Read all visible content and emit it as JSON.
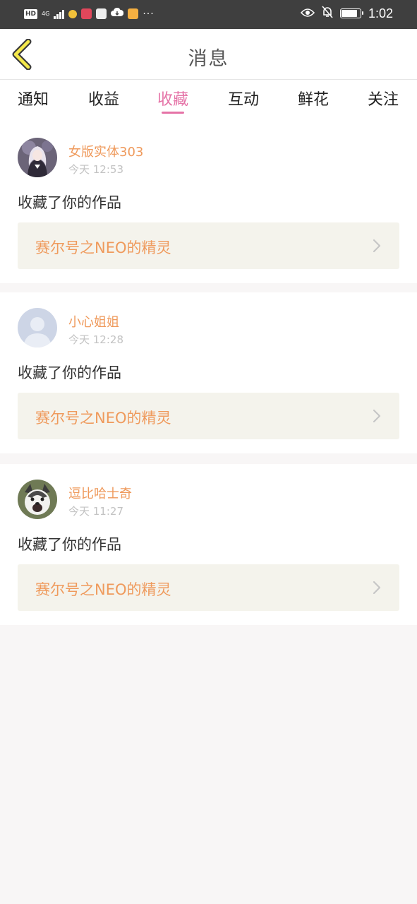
{
  "status_bar": {
    "hd": "HD",
    "network": "4G",
    "time": "1:02",
    "battery_level": 0.85,
    "overflow": "···"
  },
  "header": {
    "title": "消息",
    "back_icon": "chevron-left-icon"
  },
  "tabs": [
    {
      "label": "通知",
      "active": false
    },
    {
      "label": "收益",
      "active": false
    },
    {
      "label": "收藏",
      "active": true
    },
    {
      "label": "互动",
      "active": false
    },
    {
      "label": "鲜花",
      "active": false
    },
    {
      "label": "关注",
      "active": false
    }
  ],
  "messages": [
    {
      "username": "女版实体303",
      "time": "今天 12:53",
      "action": "收藏了你的作品",
      "work_title": "赛尔号之NEO的精灵",
      "avatar": "anime-girl-avatar"
    },
    {
      "username": "小心姐姐",
      "time": "今天 12:28",
      "action": "收藏了你的作品",
      "work_title": "赛尔号之NEO的精灵",
      "avatar": "default-user-avatar"
    },
    {
      "username": "逗比哈士奇",
      "time": "今天 11:27",
      "action": "收藏了你的作品",
      "work_title": "赛尔号之NEO的精灵",
      "avatar": "husky-avatar"
    }
  ],
  "colors": {
    "accent_pink": "#e573a7",
    "username_orange": "#ef9a5c",
    "work_box_bg": "#f4f3ec"
  }
}
